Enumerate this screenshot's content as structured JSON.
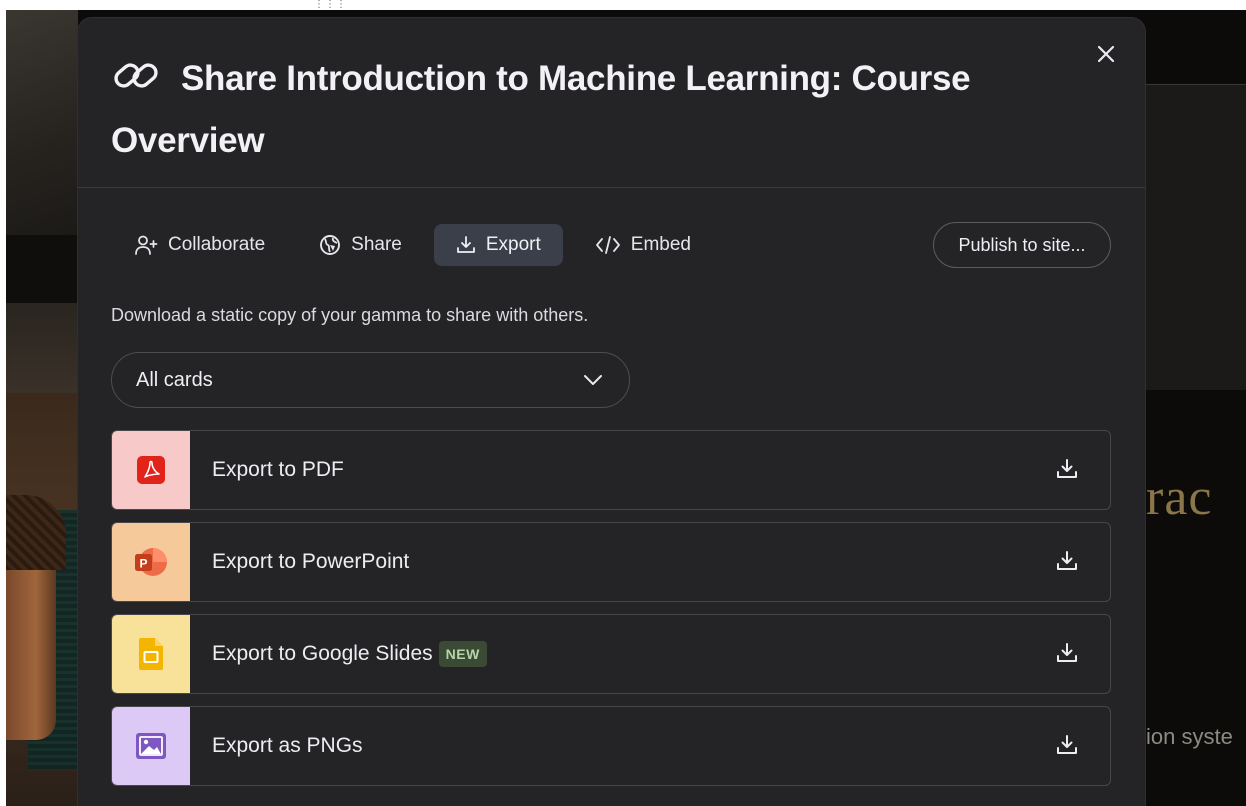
{
  "modal": {
    "title": "Share Introduction to Machine Learning: Course Overview",
    "tabs": [
      {
        "label": "Collaborate",
        "icon": "add-user-icon",
        "active": false
      },
      {
        "label": "Share",
        "icon": "globe-icon",
        "active": false
      },
      {
        "label": "Export",
        "icon": "download-icon",
        "active": true
      },
      {
        "label": "Embed",
        "icon": "code-icon",
        "active": false
      }
    ],
    "publish_label": "Publish to site...",
    "description": "Download a static copy of your gamma to share with others.",
    "cards_select": {
      "value": "All cards"
    },
    "exports": [
      {
        "label": "Export to PDF",
        "icon": "pdf-icon",
        "swatch": "#f8c9c9",
        "badge": ""
      },
      {
        "label": "Export to PowerPoint",
        "icon": "powerpoint-icon",
        "swatch": "#f6c99a",
        "badge": ""
      },
      {
        "label": "Export to Google Slides",
        "icon": "google-slides-icon",
        "swatch": "#f8e29a",
        "badge": "NEW"
      },
      {
        "label": "Export as PNGs",
        "icon": "image-icon",
        "swatch": "#dcc9f6",
        "badge": ""
      }
    ]
  },
  "background": {
    "slide_text": "rac",
    "slide_subtext": "ion syste"
  },
  "colors": {
    "modal_bg": "#242427",
    "active_tab": "#3b3f49",
    "pdf_red": "#e2231a",
    "ppt_orange": "#d35230",
    "slides_yellow": "#f5b400",
    "png_purple": "#7e57c2"
  }
}
